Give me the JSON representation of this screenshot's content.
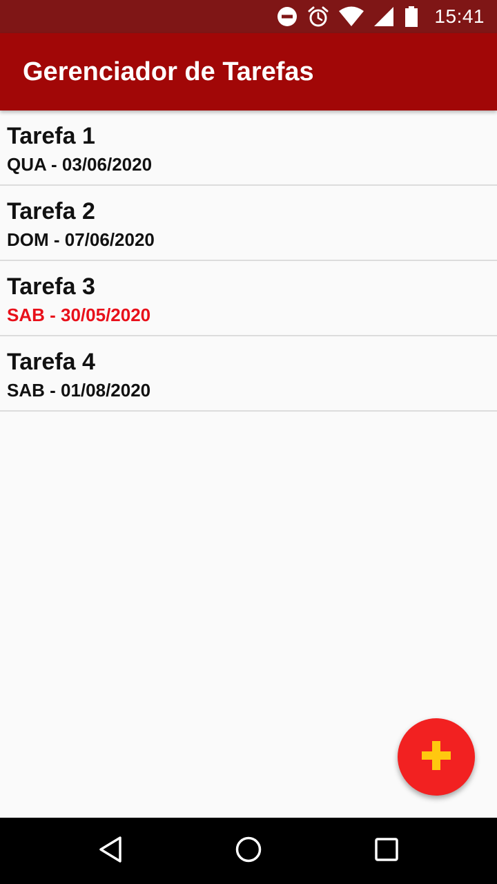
{
  "status_bar": {
    "time": "15:41",
    "icons": [
      "do-not-disturb-icon",
      "alarm-icon",
      "wifi-icon",
      "signal-icon",
      "battery-icon"
    ]
  },
  "app_bar": {
    "title": "Gerenciador de Tarefas"
  },
  "tasks": [
    {
      "title": "Tarefa 1",
      "date": "QUA - 03/06/2020",
      "overdue": false
    },
    {
      "title": "Tarefa 2",
      "date": "DOM - 07/06/2020",
      "overdue": false
    },
    {
      "title": "Tarefa 3",
      "date": "SAB - 30/05/2020",
      "overdue": true
    },
    {
      "title": "Tarefa 4",
      "date": "SAB - 01/08/2020",
      "overdue": false
    }
  ],
  "fab": {
    "icon": "plus-icon"
  },
  "nav_bar": {
    "icons": [
      "back-icon",
      "home-icon",
      "recents-icon"
    ]
  },
  "colors": {
    "status_bar": "#7f1616",
    "app_bar": "#a10707",
    "fab": "#f22121",
    "fab_icon": "#ffc80f",
    "overdue_date": "#e8101a",
    "background": "#fafafa"
  }
}
